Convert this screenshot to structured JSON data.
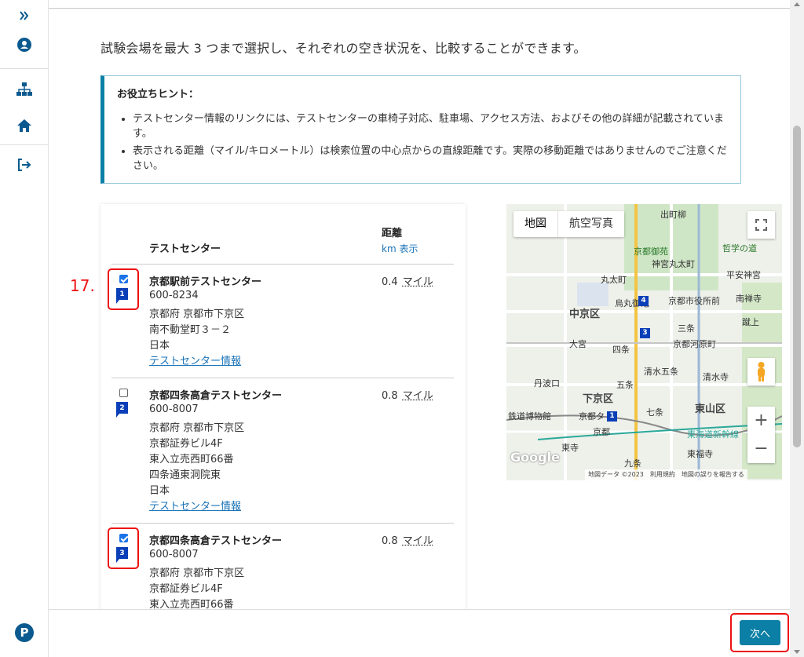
{
  "sidebar": {
    "expand_icon": "double-chevron-right-icon",
    "profile_icon": "user-circle-icon",
    "sitemap_icon": "sitemap-icon",
    "home_icon": "home-icon",
    "logout_icon": "sign-out-icon",
    "brand_letter": "P"
  },
  "intro_text": "試験会場を最大 3 つまで選択し、それぞれの空き状況を、比較することができます。",
  "hint": {
    "title": "お役立ちヒント：",
    "items": [
      "テストセンター情報のリンクには、テストセンターの車椅子対応、駐車場、アクセス方法、およびその他の詳細が記載されています。",
      "表示される距離（マイル/キロメートル）は検索位置の中心点からの直線距離です。実際の移動距離ではありませんのでご注意ください。"
    ]
  },
  "table": {
    "col_name": "テストセンター",
    "col_distance": "距離",
    "km_toggle": "km 表示",
    "rows": [
      {
        "checked": true,
        "marker": "1",
        "name": "京都駅前テストセンター",
        "lines": [
          "600-8234",
          "京都府 京都市下京区",
          "南不動堂町３－２",
          "日本"
        ],
        "link": "テストセンター情報",
        "distance": "0.4",
        "unit": "マイル"
      },
      {
        "checked": false,
        "marker": "2",
        "name": "京都四条高倉テストセンター",
        "lines": [
          "600-8007",
          "京都府 京都市下京区",
          "京都証券ビル4F",
          "東入立売西町66番",
          "四条通東洞院東",
          "日本"
        ],
        "link": "テストセンター情報",
        "distance": "0.8",
        "unit": "マイル"
      },
      {
        "checked": true,
        "marker": "3",
        "name": "京都四条高倉テストセンター",
        "lines": [
          "600-8007",
          "京都府 京都市下京区",
          "京都証券ビル4F",
          "東入立売西町66番"
        ],
        "link": "",
        "distance": "0.8",
        "unit": "マイル"
      }
    ]
  },
  "step_label": "17.",
  "map": {
    "tab_map": "地図",
    "tab_satellite": "航空写真",
    "zoom_in": "+",
    "zoom_out": "−",
    "google": "Google",
    "footer": [
      "地図データ ©2023",
      "利用規約",
      "地図の誤りを報告する"
    ],
    "labels": [
      "京都御苑",
      "中京区",
      "下京区",
      "東山区",
      "丸太町",
      "四条",
      "五条",
      "七条",
      "京都",
      "東寺",
      "九条",
      "東福寺",
      "平安神宮",
      "南禅寺",
      "哲学の道",
      "清水寺",
      "京都市役所前",
      "丹波口",
      "大宮",
      "烏丸御池",
      "三条",
      "京都河原町",
      "神宮丸太町",
      "出町柳",
      "清水五条",
      "東海道新幹線",
      "蹴上",
      "鉄道博物館",
      "京都タ"
    ]
  },
  "next_button": "次へ"
}
